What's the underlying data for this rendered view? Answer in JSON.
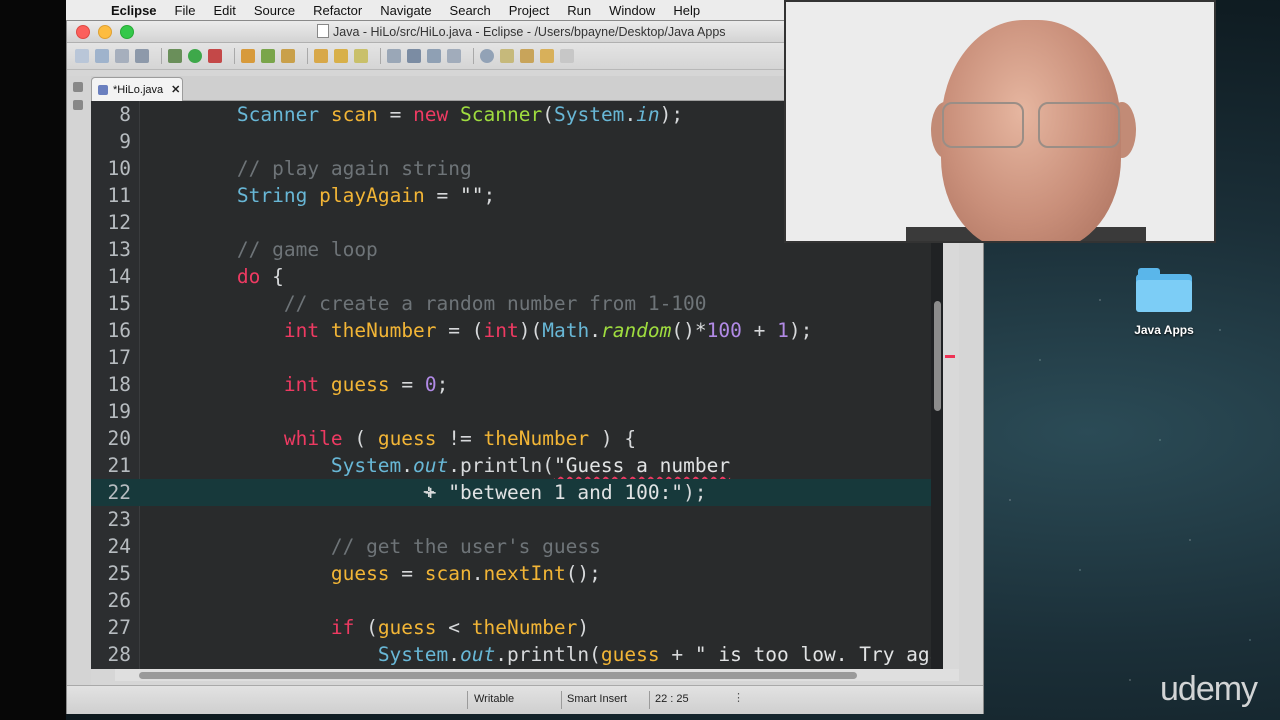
{
  "menubar": {
    "app": "Eclipse",
    "items": [
      "File",
      "Edit",
      "Source",
      "Refactor",
      "Navigate",
      "Search",
      "Project",
      "Run",
      "Window",
      "Help"
    ]
  },
  "window": {
    "title": "Java - HiLo/src/HiLo.java - Eclipse - /Users/bpayne/Desktop/Java Apps"
  },
  "editor": {
    "tab_label": "*HiLo.java",
    "tab_close": "✕",
    "lines": [
      {
        "n": "8"
      },
      {
        "n": "9"
      },
      {
        "n": "10"
      },
      {
        "n": "11"
      },
      {
        "n": "12"
      },
      {
        "n": "13"
      },
      {
        "n": "14"
      },
      {
        "n": "15"
      },
      {
        "n": "16"
      },
      {
        "n": "17"
      },
      {
        "n": "18"
      },
      {
        "n": "19"
      },
      {
        "n": "20"
      },
      {
        "n": "21"
      },
      {
        "n": "22"
      },
      {
        "n": "23"
      },
      {
        "n": "24"
      },
      {
        "n": "25"
      },
      {
        "n": "26"
      },
      {
        "n": "27"
      },
      {
        "n": "28"
      }
    ]
  },
  "statusbar": {
    "writable": "Writable",
    "insert_mode": "Smart Insert",
    "position": "22 : 25"
  },
  "desktop": {
    "folder_label": "Java Apps",
    "watermark": "udemy"
  },
  "colors": {
    "keyword": "#ee3a62",
    "type": "#68b7d6",
    "variable": "#f2b536",
    "method": "#9fdd3f",
    "comment": "#6e7478",
    "number": "#b18ae6",
    "current_line": "#17393b"
  }
}
